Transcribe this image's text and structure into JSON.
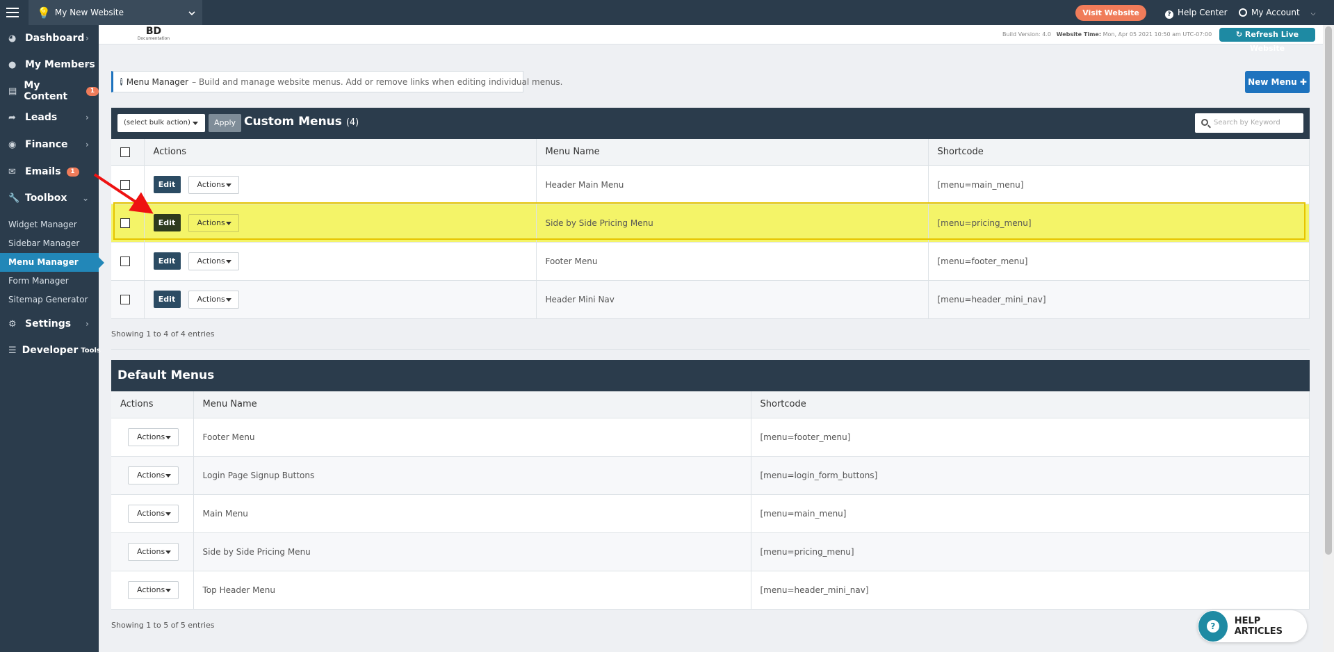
{
  "topbar": {
    "site_name": "My New Website",
    "visit_label": "Visit Website",
    "help_label": "Help Center",
    "account_label": "My Account"
  },
  "sidebar": {
    "items": [
      {
        "label": "Dashboard",
        "icon": "dashboard-icon"
      },
      {
        "label": "My Members",
        "icon": "members-icon"
      },
      {
        "label": "My Content",
        "icon": "content-icon",
        "badge": "1"
      },
      {
        "label": "Leads",
        "icon": "share-icon"
      },
      {
        "label": "Finance",
        "icon": "finance-icon"
      },
      {
        "label": "Emails",
        "icon": "emails-icon",
        "badge": "1"
      },
      {
        "label": "Toolbox",
        "icon": "wrench-icon"
      }
    ],
    "sub_items": [
      "Widget Manager",
      "Sidebar Manager",
      "Menu Manager",
      "Form Manager",
      "Sitemap Generator"
    ],
    "settings_label": "Settings",
    "developer_label": "Developer",
    "developer_suffix": "Tools"
  },
  "header": {
    "logo_big": "BD",
    "logo_small": "Documentation",
    "build_label": "Build Version: 4.0",
    "time_label": "Website Time:",
    "time_value": "Mon, Apr 05 2021 10:50 am UTC-07:00",
    "refresh_label": "Refresh Live Website"
  },
  "info": {
    "title": "Menu Manager",
    "text": "– Build and manage website menus. Add or remove links when editing individual menus."
  },
  "new_menu_label": "New Menu",
  "custom": {
    "bulk_label": "(select bulk action)",
    "apply_label": "Apply",
    "title": "Custom Menus",
    "count": "(4)",
    "search_placeholder": "Search by Keyword",
    "headers": [
      "Actions",
      "Menu Name",
      "Shortcode"
    ],
    "edit_label": "Edit",
    "actions_label": "Actions",
    "rows": [
      {
        "name": "Header Main Menu",
        "shortcode": "[menu=main_menu]"
      },
      {
        "name": "Side by Side Pricing Menu",
        "shortcode": "[menu=pricing_menu]"
      },
      {
        "name": "Footer Menu",
        "shortcode": "[menu=footer_menu]"
      },
      {
        "name": "Header Mini Nav",
        "shortcode": "[menu=header_mini_nav]"
      }
    ],
    "showing": "Showing 1 to 4 of 4 entries"
  },
  "defaults": {
    "title": "Default Menus",
    "headers": [
      "Actions",
      "Menu Name",
      "Shortcode"
    ],
    "actions_label": "Actions",
    "rows": [
      {
        "name": "Footer Menu",
        "shortcode": "[menu=footer_menu]"
      },
      {
        "name": "Login Page Signup Buttons",
        "shortcode": "[menu=login_form_buttons]"
      },
      {
        "name": "Main Menu",
        "shortcode": "[menu=main_menu]"
      },
      {
        "name": "Side by Side Pricing Menu",
        "shortcode": "[menu=pricing_menu]"
      },
      {
        "name": "Top Header Menu",
        "shortcode": "[menu=header_mini_nav]"
      }
    ],
    "showing": "Showing 1 to 5 of 5 entries"
  },
  "help_articles_label": "HELP ARTICLES",
  "colors": {
    "navy": "#2b3c4c",
    "accent_blue": "#1e73be",
    "orange": "#f07c5a",
    "teal": "#1e8aa3",
    "highlight": "#f4f468"
  }
}
